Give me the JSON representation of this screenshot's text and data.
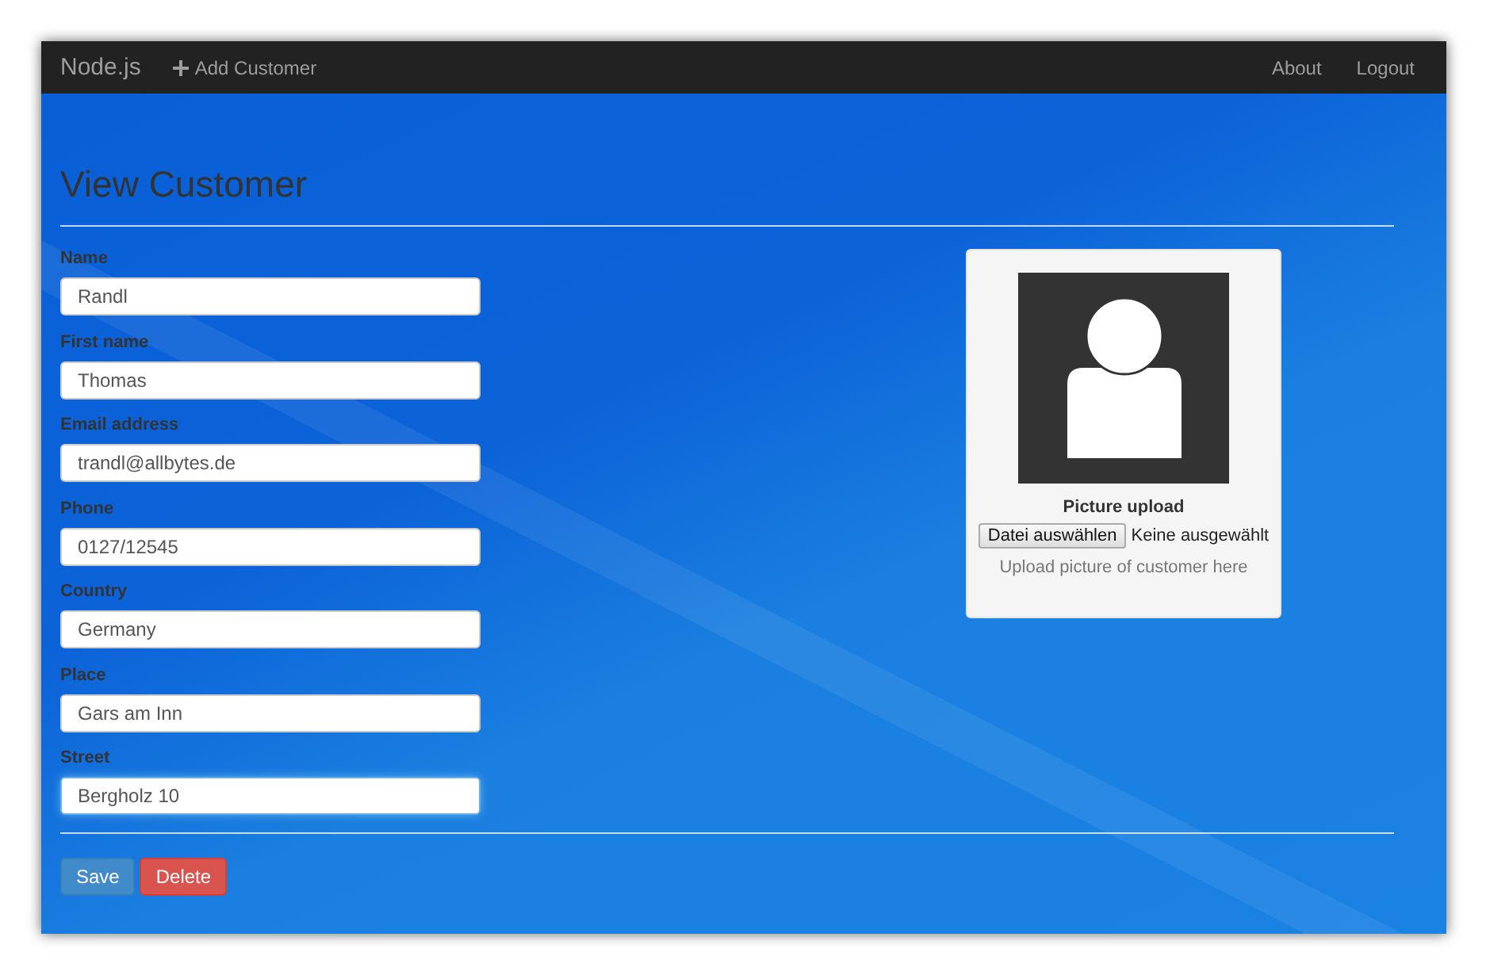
{
  "navbar": {
    "brand": "Node.js",
    "links": [
      {
        "label": "Add Customer"
      }
    ],
    "right_links": [
      "About",
      "Logout"
    ]
  },
  "page_title": "View Customer",
  "fields": [
    {
      "label": "Name",
      "value": "Randl",
      "focused": false
    },
    {
      "label": "First name",
      "value": "Thomas",
      "focused": false
    },
    {
      "label": "Email address",
      "value": "trandl@allbytes.de",
      "focused": false
    },
    {
      "label": "Phone",
      "value": "0127/12545",
      "focused": false
    },
    {
      "label": "Country",
      "value": "Germany",
      "focused": false
    },
    {
      "label": "Place",
      "value": "Gars am Inn",
      "focused": false
    },
    {
      "label": "Street",
      "value": "Bergholz 10",
      "focused": true
    }
  ],
  "picture_panel": {
    "label": "Picture upload",
    "file_button": "Datei auswählen",
    "file_status": "Keine ausgewählt",
    "help": "Upload picture of customer here"
  },
  "buttons": [
    {
      "label": "Save",
      "kind": "primary"
    },
    {
      "label": "Delete",
      "kind": "danger"
    }
  ]
}
